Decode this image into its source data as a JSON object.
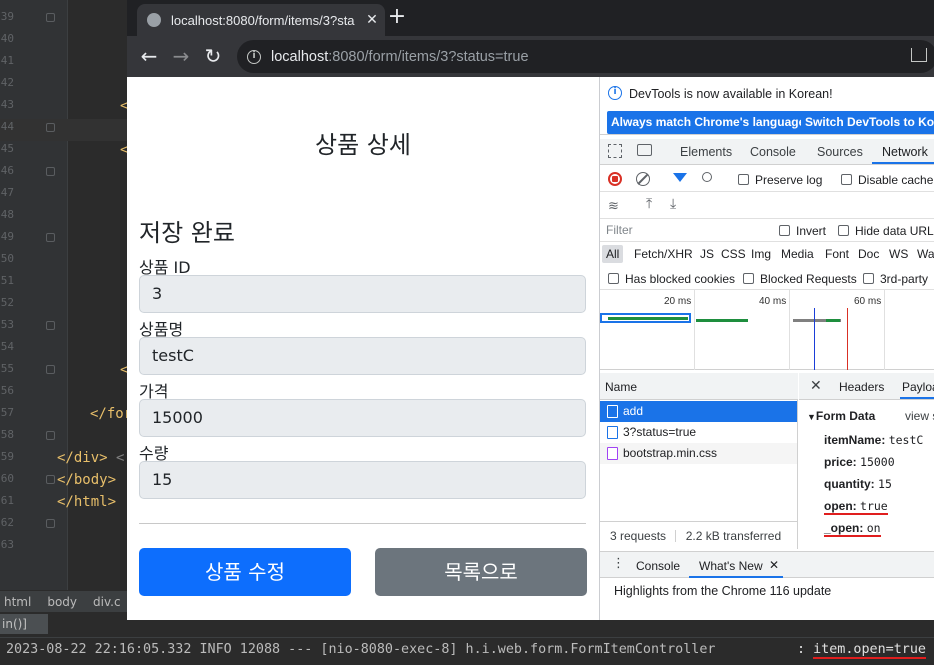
{
  "ide": {
    "line_numbers": [
      "39",
      "40",
      "41",
      "42",
      "43",
      "44",
      "45",
      "46",
      "47",
      "48",
      "49",
      "50",
      "51",
      "52",
      "53",
      "54",
      "55",
      "56",
      "57",
      "58",
      "59",
      "60",
      "61",
      "62",
      "63"
    ],
    "code_lines": [
      {
        "text": "<",
        "cls": ""
      },
      {
        "text": "<",
        "cls": ""
      },
      {
        "text": "<",
        "cls": ""
      },
      {
        "text": "</for",
        "cls": ""
      },
      {
        "text": "</div>",
        "cls": "",
        "tail": " <!"
      },
      {
        "text": "</body>",
        "cls": ""
      },
      {
        "text": "</html>",
        "cls": ""
      }
    ],
    "breadcrumbs": [
      "html",
      "body",
      "div.c"
    ],
    "run_tab": "in()]",
    "console_log": "2023-08-22 22:16:05.332  INFO 12088 --- [nio-8080-exec-8] h.i.web.form.FormItemController",
    "console_highlight": ": item.open=true",
    "console_highlight_prefix": ": ",
    "console_highlight_value": "item.open=true"
  },
  "browser": {
    "tab_title": "localhost:8080/form/items/3?sta",
    "tab_close": "✕",
    "new_tab": "+",
    "url_host": "localhost",
    "url_rest": ":8080/form/items/3?status=true",
    "nav": {
      "back": "←",
      "forward": "→",
      "reload": "↻"
    }
  },
  "page": {
    "heading": "상품 상세",
    "status_message": "저장 완료",
    "fields": [
      {
        "label": "상품 ID",
        "value": "3"
      },
      {
        "label": "상품명",
        "value": "testC"
      },
      {
        "label": "가격",
        "value": "15000"
      },
      {
        "label": "수량",
        "value": "15"
      }
    ],
    "edit_button": "상품 수정",
    "list_button": "목록으로"
  },
  "devtools": {
    "info_message": "DevTools is now available in Korean!",
    "btn_match_language": "Always match Chrome's language",
    "btn_switch_korean": "Switch DevTools to Kore",
    "tabs": [
      "Elements",
      "Console",
      "Sources",
      "Network"
    ],
    "active_tab": "Network",
    "preserve_log": "Preserve log",
    "disable_cache": "Disable cache",
    "filter_placeholder": "Filter",
    "invert": "Invert",
    "hide_data_urls": "Hide data URLs",
    "type_filters": [
      "All",
      "Fetch/XHR",
      "JS",
      "CSS",
      "Img",
      "Media",
      "Font",
      "Doc",
      "WS",
      "Wa"
    ],
    "has_blocked_cookies": "Has blocked cookies",
    "blocked_requests": "Blocked Requests",
    "third_party": "3rd-party",
    "timeline_labels": [
      "20 ms",
      "40 ms",
      "60 ms"
    ],
    "name_header": "Name",
    "requests": [
      {
        "name": "add",
        "selected": true,
        "type": "doc"
      },
      {
        "name": "3?status=true",
        "selected": false,
        "type": "doc"
      },
      {
        "name": "bootstrap.min.css",
        "selected": false,
        "type": "css"
      }
    ],
    "summary_requests": "3 requests",
    "summary_transferred": "2.2 kB transferred",
    "detail_close": "✕",
    "detail_tabs": [
      "Headers",
      "Payloa"
    ],
    "form_data_title": "Form Data",
    "view_source": "view s",
    "form_data": [
      {
        "key": "itemName:",
        "value": "testC",
        "highlight": false
      },
      {
        "key": "price:",
        "value": "15000",
        "highlight": false
      },
      {
        "key": "quantity:",
        "value": "15",
        "highlight": false
      },
      {
        "key": "open:",
        "value": "true",
        "highlight": true
      },
      {
        "key": "_open:",
        "value": "on",
        "highlight": true
      }
    ],
    "drawer_tabs": [
      "Console",
      "What's New"
    ],
    "drawer_close": "✕",
    "drawer_message": "Highlights from the Chrome 116 update"
  },
  "colors": {
    "primary": "#0d6efd",
    "secondary": "#6c757d",
    "devtools_blue": "#1a73e8",
    "annotation_red": "#e01e1e"
  }
}
